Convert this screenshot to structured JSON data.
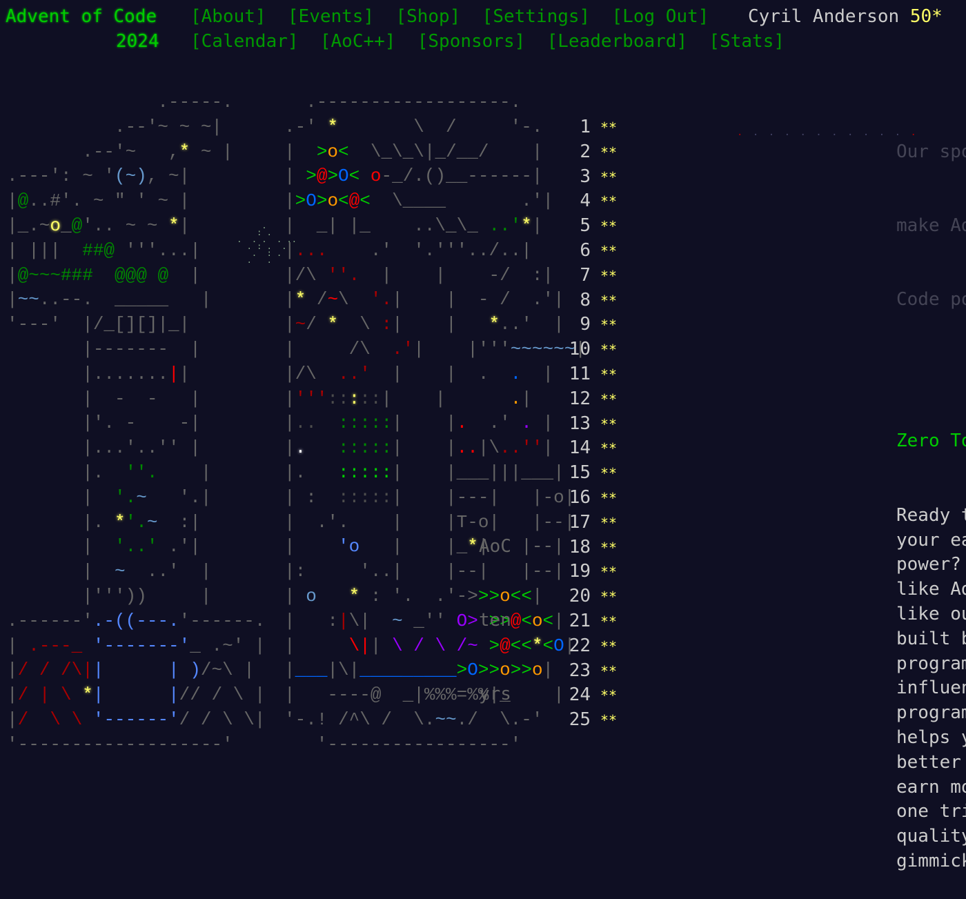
{
  "header": {
    "title_line1": "Advent of Code",
    "title_line2": "2024",
    "nav_row1": [
      "[About]",
      "[Events]",
      "[Shop]",
      "[Settings]",
      "[Log Out]"
    ],
    "nav_row2": [
      "[Calendar]",
      "[AoC++]",
      "[Sponsors]",
      "[Leaderboard]",
      "[Stats]"
    ],
    "user_name": "Cyril Anderson",
    "user_stars": "50*"
  },
  "calendar": {
    "days": [
      {
        "day": "1",
        "stars": "**"
      },
      {
        "day": "2",
        "stars": "**"
      },
      {
        "day": "3",
        "stars": "**"
      },
      {
        "day": "4",
        "stars": "**"
      },
      {
        "day": "5",
        "stars": "**"
      },
      {
        "day": "6",
        "stars": "**"
      },
      {
        "day": "7",
        "stars": "**"
      },
      {
        "day": "8",
        "stars": "**"
      },
      {
        "day": "9",
        "stars": "**"
      },
      {
        "day": "10",
        "stars": "**"
      },
      {
        "day": "11",
        "stars": "**"
      },
      {
        "day": "12",
        "stars": "**"
      },
      {
        "day": "13",
        "stars": "**"
      },
      {
        "day": "14",
        "stars": "**"
      },
      {
        "day": "15",
        "stars": "**"
      },
      {
        "day": "16",
        "stars": "**"
      },
      {
        "day": "17",
        "stars": "**"
      },
      {
        "day": "18",
        "stars": "**"
      },
      {
        "day": "19",
        "stars": "**"
      },
      {
        "day": "20",
        "stars": "**"
      },
      {
        "day": "21",
        "stars": "**"
      },
      {
        "day": "22",
        "stars": "**"
      },
      {
        "day": "23",
        "stars": "**"
      },
      {
        "day": "24",
        "stars": "**"
      },
      {
        "day": "25",
        "stars": "**"
      }
    ],
    "art_box_text": [
      "AoC",
      "ten",
      "yrs"
    ]
  },
  "sidebar": {
    "sponsor_lines": [
      "Our spo",
      "make Ad",
      "Code po"
    ],
    "sponsor_title": "Zero To",
    "sponsor_body": [
      "Ready t",
      "your ea",
      "power?",
      "like Ad",
      "like ou",
      "built b",
      "program",
      "influen",
      "program",
      "helps y",
      "better",
      "earn mo",
      "one tri",
      "quality",
      "gimmick"
    ]
  },
  "colors": {
    "background": "#0f0f23",
    "title_green": "#00cc00",
    "link_green": "#009900",
    "star_yellow": "#ffff66",
    "text_gray": "#cccccc"
  }
}
